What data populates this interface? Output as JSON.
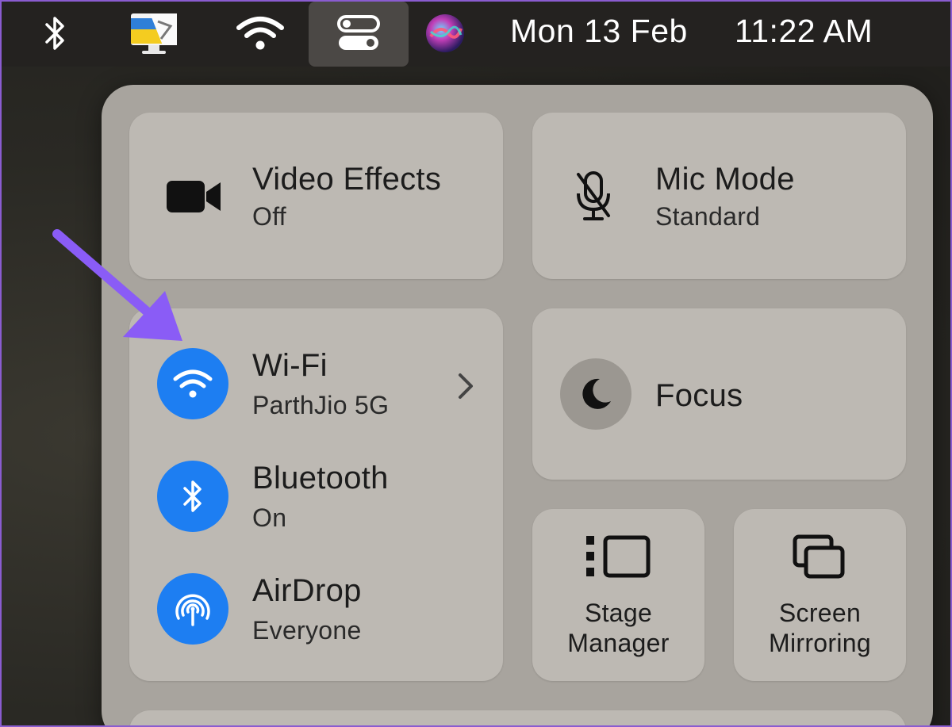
{
  "menubar": {
    "date": "Mon 13 Feb",
    "time": "11:22 AM",
    "icons": [
      "bluetooth-icon",
      "display-flag-icon",
      "wifi-icon",
      "control-center-icon",
      "siri-icon"
    ]
  },
  "control_center": {
    "video_effects": {
      "title": "Video Effects",
      "status": "Off",
      "icon": "video-camera-icon"
    },
    "mic_mode": {
      "title": "Mic Mode",
      "status": "Standard",
      "icon": "mic-slash-icon"
    },
    "wifi": {
      "title": "Wi-Fi",
      "status": "ParthJio 5G",
      "icon": "wifi-icon"
    },
    "bluetooth": {
      "title": "Bluetooth",
      "status": "On",
      "icon": "bluetooth-icon"
    },
    "airdrop": {
      "title": "AirDrop",
      "status": "Everyone",
      "icon": "airdrop-icon"
    },
    "focus": {
      "title": "Focus",
      "icon": "moon-icon"
    },
    "stage_manager": {
      "line1": "Stage",
      "line2": "Manager",
      "icon": "stage-manager-icon"
    },
    "screen_mirroring": {
      "line1": "Screen",
      "line2": "Mirroring",
      "icon": "screen-mirroring-icon"
    }
  },
  "colors": {
    "accent_blue": "#1d7ef2",
    "annotation_arrow": "#8a5cf6",
    "panel": "#a8a49e",
    "tile": "#bdb9b3"
  }
}
